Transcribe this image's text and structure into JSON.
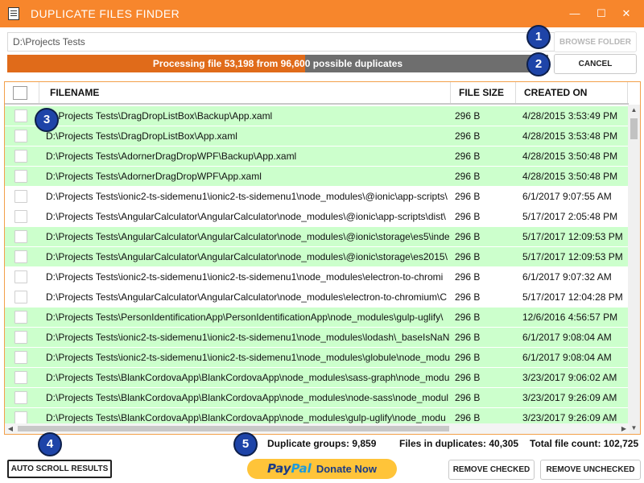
{
  "window": {
    "title": "DUPLICATE FILES FINDER",
    "minimize_glyph": "—",
    "maximize_glyph": "☐",
    "close_glyph": "✕"
  },
  "toolbar": {
    "path_value": "D:\\Projects Tests",
    "browse_label": "BROWSE FOLDER",
    "cancel_label": "CANCEL"
  },
  "progress": {
    "text": "Processing file 53,198 from 96,600 possible duplicates",
    "fraction": 0.551
  },
  "grid": {
    "columns": [
      "FILENAME",
      "FILE SIZE",
      "CREATED ON"
    ],
    "rows": [
      {
        "name": "D:\\Projects Tests\\DragDropListBox\\Backup\\App.xaml",
        "size": "296 B",
        "created": "4/28/2015 3:53:49 PM",
        "dup": true
      },
      {
        "name": "D:\\Projects Tests\\DragDropListBox\\App.xaml",
        "size": "296 B",
        "created": "4/28/2015 3:53:48 PM",
        "dup": true
      },
      {
        "name": "D:\\Projects Tests\\AdornerDragDropWPF\\Backup\\App.xaml",
        "size": "296 B",
        "created": "4/28/2015 3:50:48 PM",
        "dup": true
      },
      {
        "name": "D:\\Projects Tests\\AdornerDragDropWPF\\App.xaml",
        "size": "296 B",
        "created": "4/28/2015 3:50:48 PM",
        "dup": true
      },
      {
        "name": "D:\\Projects Tests\\ionic2-ts-sidemenu1\\ionic2-ts-sidemenu1\\node_modules\\@ionic\\app-scripts\\",
        "size": "296 B",
        "created": "6/1/2017 9:07:55 AM",
        "dup": false
      },
      {
        "name": "D:\\Projects Tests\\AngularCalculator\\AngularCalculator\\node_modules\\@ionic\\app-scripts\\dist\\",
        "size": "296 B",
        "created": "5/17/2017 2:05:48 PM",
        "dup": false
      },
      {
        "name": "D:\\Projects Tests\\AngularCalculator\\AngularCalculator\\node_modules\\@ionic\\storage\\es5\\inde",
        "size": "296 B",
        "created": "5/17/2017 12:09:53 PM",
        "dup": true
      },
      {
        "name": "D:\\Projects Tests\\AngularCalculator\\AngularCalculator\\node_modules\\@ionic\\storage\\es2015\\",
        "size": "296 B",
        "created": "5/17/2017 12:09:53 PM",
        "dup": true
      },
      {
        "name": "D:\\Projects Tests\\ionic2-ts-sidemenu1\\ionic2-ts-sidemenu1\\node_modules\\electron-to-chromi",
        "size": "296 B",
        "created": "6/1/2017 9:07:32 AM",
        "dup": false
      },
      {
        "name": "D:\\Projects Tests\\AngularCalculator\\AngularCalculator\\node_modules\\electron-to-chromium\\C",
        "size": "296 B",
        "created": "5/17/2017 12:04:28 PM",
        "dup": false
      },
      {
        "name": "D:\\Projects Tests\\PersonIdentificationApp\\PersonIdentificationApp\\node_modules\\gulp-uglify\\",
        "size": "296 B",
        "created": "12/6/2016 4:56:57 PM",
        "dup": true
      },
      {
        "name": "D:\\Projects Tests\\ionic2-ts-sidemenu1\\ionic2-ts-sidemenu1\\node_modules\\lodash\\_baseIsNaN",
        "size": "296 B",
        "created": "6/1/2017 9:08:04 AM",
        "dup": true
      },
      {
        "name": "D:\\Projects Tests\\ionic2-ts-sidemenu1\\ionic2-ts-sidemenu1\\node_modules\\globule\\node_modu",
        "size": "296 B",
        "created": "6/1/2017 9:08:04 AM",
        "dup": true
      },
      {
        "name": "D:\\Projects Tests\\BlankCordovaApp\\BlankCordovaApp\\node_modules\\sass-graph\\node_modu",
        "size": "296 B",
        "created": "3/23/2017 9:06:02 AM",
        "dup": true
      },
      {
        "name": "D:\\Projects Tests\\BlankCordovaApp\\BlankCordovaApp\\node_modules\\node-sass\\node_modul",
        "size": "296 B",
        "created": "3/23/2017 9:26:09 AM",
        "dup": true
      },
      {
        "name": "D:\\Projects Tests\\BlankCordovaApp\\BlankCordovaApp\\node_modules\\gulp-uglify\\node_modu",
        "size": "296 B",
        "created": "3/23/2017 9:26:09 AM",
        "dup": true
      }
    ]
  },
  "stats": {
    "groups": "Duplicate groups: 9,859",
    "files": "Files in duplicates: 40,305",
    "total": "Total file count: 102,725"
  },
  "footer": {
    "auto_scroll_label": "AUTO SCROLL RESULTS",
    "paypal_pay": "Pay",
    "paypal_pal": "Pal",
    "donate_label": "Donate Now",
    "remove_checked_label": "REMOVE CHECKED",
    "remove_unchecked_label": "REMOVE UNCHECKED"
  },
  "badges": [
    "1",
    "2",
    "3",
    "4",
    "5"
  ],
  "colors": {
    "titlebar": "#f7862c",
    "progress_fill": "#e06b1a",
    "progress_track": "#6e6e6e",
    "duplicate_row": "#ccffcc",
    "badge": "#1e44a8",
    "paypal": "#ffc439"
  }
}
